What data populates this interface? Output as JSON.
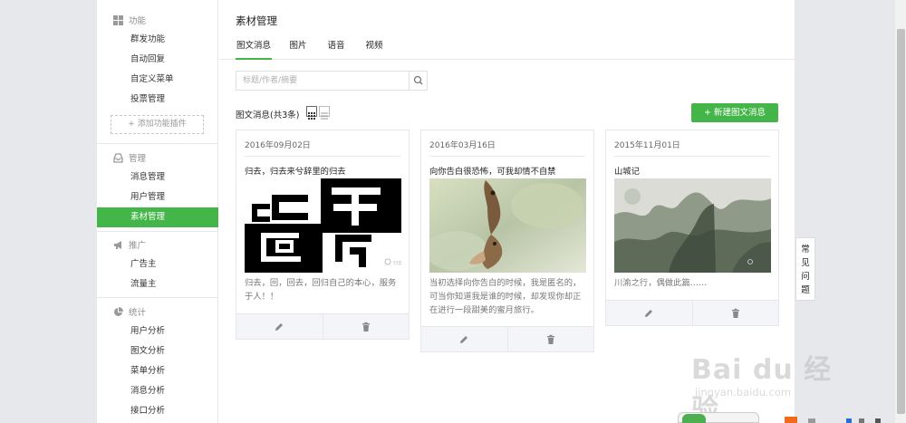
{
  "sidebar": {
    "sections": [
      {
        "label": "功能",
        "icon": "grid-icon",
        "items": [
          "群发功能",
          "自动回复",
          "自定义菜单",
          "投票管理"
        ]
      },
      {
        "label": "管理",
        "icon": "inbox-icon",
        "items": [
          "消息管理",
          "用户管理",
          "素材管理"
        ]
      },
      {
        "label": "推广",
        "icon": "megaphone-icon",
        "items": [
          "广告主",
          "流量主"
        ]
      },
      {
        "label": "统计",
        "icon": "pie-chart-icon",
        "items": [
          "用户分析",
          "图文分析",
          "菜单分析",
          "消息分析",
          "接口分析"
        ]
      }
    ],
    "add_plugin": "+ 添加功能插件",
    "active_item": "素材管理"
  },
  "header": {
    "title": "素材管理"
  },
  "tabs": [
    "图文消息",
    "图片",
    "语音",
    "视频"
  ],
  "active_tab": "图文消息",
  "search": {
    "placeholder": "标题/作者/摘要",
    "value": ""
  },
  "list": {
    "count_label": "图文消息(共3条)",
    "new_button": "+ 新建图文消息"
  },
  "cards": [
    {
      "date": "2016年09月02日",
      "title": "归去，归去来兮辞里的归去",
      "desc": "归去，回，回去，回归自己的本心，服务于人！！",
      "image": "calligraphy"
    },
    {
      "date": "2016年03月16日",
      "title": "向你告白很恐怖，可我却情不自禁",
      "desc": "当初选择向你告白的时候，我是匿名的，可当你知道我是谁的时候，却发现你却正在进行一段甜美的蜜月旅行。",
      "image": "birds"
    },
    {
      "date": "2015年11月01日",
      "title": "山城记",
      "desc": "川渝之行，偶做此篇……",
      "image": "landscape"
    }
  ],
  "faq": "常见问题",
  "watermark": {
    "brand": "Bai du 经验",
    "url": "jingyan.baidu.com"
  },
  "colors": {
    "accent": "#44b549",
    "background": "#e7e8eb"
  }
}
